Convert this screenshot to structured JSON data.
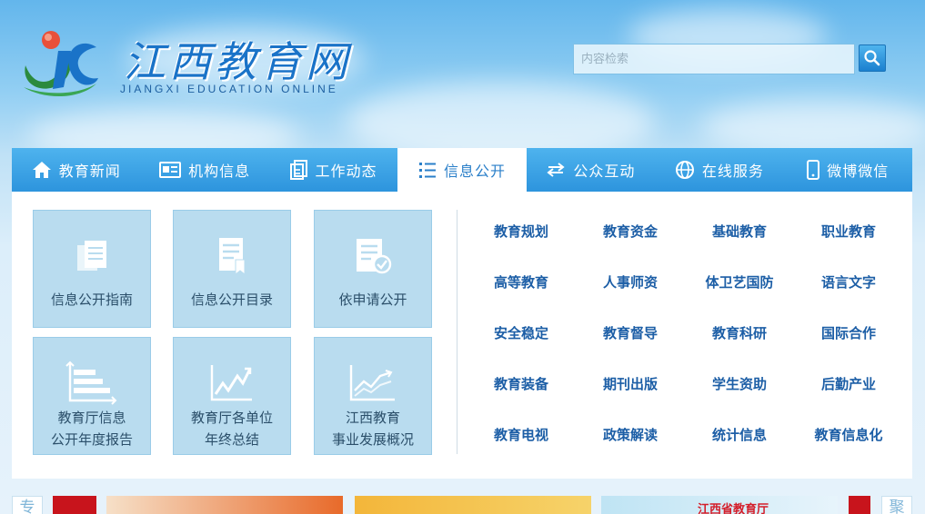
{
  "header": {
    "logo_cn": "江西教育网",
    "logo_en": "JIANGXI EDUCATION ONLINE",
    "search_placeholder": "内容检索"
  },
  "nav": {
    "items": [
      {
        "label": "教育新闻",
        "icon": "home-icon"
      },
      {
        "label": "机构信息",
        "icon": "id-card-icon"
      },
      {
        "label": "工作动态",
        "icon": "documents-icon"
      },
      {
        "label": "信息公开",
        "icon": "list-icon",
        "active": true
      },
      {
        "label": "公众互动",
        "icon": "exchange-icon"
      },
      {
        "label": "在线服务",
        "icon": "globe-icon"
      },
      {
        "label": "微博微信",
        "icon": "mobile-icon"
      }
    ]
  },
  "tiles": [
    {
      "line1": "信息公开指南",
      "line2": "",
      "icon": "document-icon"
    },
    {
      "line1": "信息公开目录",
      "line2": "",
      "icon": "bookmark-document-icon"
    },
    {
      "line1": "依申请公开",
      "line2": "",
      "icon": "checked-document-icon"
    },
    {
      "line1": "教育厅信息",
      "line2": "公开年度报告",
      "icon": "bar-chart-icon"
    },
    {
      "line1": "教育厅各单位",
      "line2": "年终总结",
      "icon": "line-chart-icon"
    },
    {
      "line1": "江西教育",
      "line2": "事业发展概况",
      "icon": "trend-chart-icon"
    }
  ],
  "links": [
    "教育规划",
    "教育资金",
    "基础教育",
    "职业教育",
    "高等教育",
    "人事师资",
    "体卫艺国防",
    "语言文字",
    "安全稳定",
    "教育督导",
    "教育科研",
    "国际合作",
    "教育装备",
    "期刊出版",
    "学生资助",
    "后勤产业",
    "教育电视",
    "政策解读",
    "统计信息",
    "教育信息化"
  ],
  "strip": {
    "left_tab": "专",
    "right_tab": "聚",
    "banner_text": "江西省教育厅"
  },
  "colors": {
    "nav_blue": "#2d94dd",
    "link_blue": "#1c5ea6",
    "tile_bg": "#b9dcef"
  }
}
